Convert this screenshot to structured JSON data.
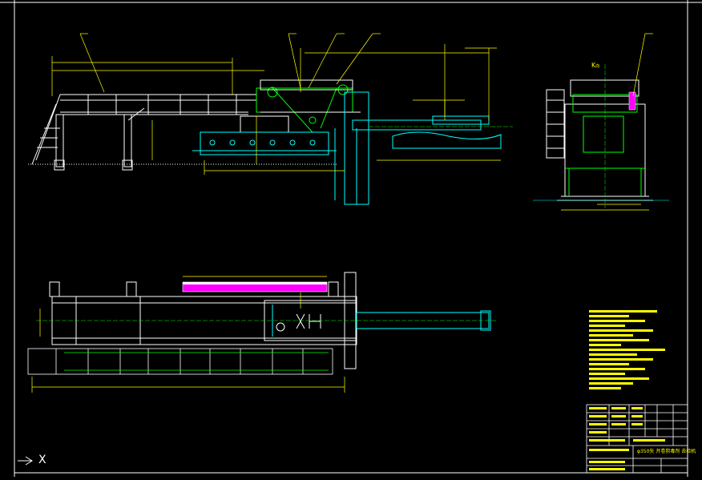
{
  "drawing": {
    "title_block_title": "φ350矢 开卷剪毒剂 去检机",
    "view_label_k": "K",
    "view_label_k_suffix": "向",
    "ucs_axis_label": "X",
    "colors": {
      "background": "#000000",
      "frame": "#ffffff",
      "structure": "#ffffff",
      "dimension": "#ffff00",
      "cyan": "#00ffff",
      "green": "#00ff00",
      "magenta": "#ff00ff",
      "red": "#ff0000"
    }
  }
}
